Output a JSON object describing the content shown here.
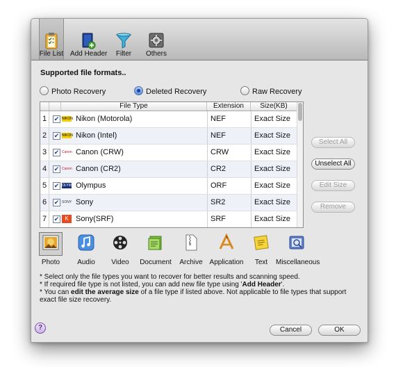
{
  "toolbar": {
    "items": [
      {
        "label": "File List",
        "icon": "clipboard-checklist-icon"
      },
      {
        "label": "Add Header",
        "icon": "book-add-icon"
      },
      {
        "label": "Filter",
        "icon": "funnel-icon"
      },
      {
        "label": "Others",
        "icon": "gear-box-icon"
      }
    ]
  },
  "heading": "Supported file formats..",
  "recovery_modes": [
    {
      "label": "Photo Recovery",
      "selected": false
    },
    {
      "label": "Deleted Recovery",
      "selected": true
    },
    {
      "label": "Raw Recovery",
      "selected": false
    }
  ],
  "table": {
    "headers": [
      "File Type",
      "Extension",
      "Size(KB)"
    ],
    "rows": [
      {
        "num": "1",
        "logo": "NIKON",
        "name": "Nikon (Motorola)",
        "ext": "NEF",
        "size": "Exact Size"
      },
      {
        "num": "2",
        "logo": "NIKON",
        "name": "Nikon (Intel)",
        "ext": "NEF",
        "size": "Exact Size"
      },
      {
        "num": "3",
        "logo": "Canon",
        "name": "Canon (CRW)",
        "ext": "CRW",
        "size": "Exact Size"
      },
      {
        "num": "4",
        "logo": "Canon",
        "name": "Canon (CR2)",
        "ext": "CR2",
        "size": "Exact Size"
      },
      {
        "num": "5",
        "logo": "OLYMPUS",
        "name": "Olympus",
        "ext": "ORF",
        "size": "Exact Size"
      },
      {
        "num": "6",
        "logo": "SONY",
        "name": "Sony",
        "ext": "SR2",
        "size": "Exact Size"
      },
      {
        "num": "7",
        "logo": "K",
        "name": "Sony(SRF)",
        "ext": "SRF",
        "size": "Exact Size"
      }
    ]
  },
  "side_buttons": {
    "select_all": "Select All",
    "unselect_all": "Unselect All",
    "edit_size": "Edit Size",
    "remove": "Remove"
  },
  "categories": [
    {
      "label": "Photo",
      "icon": "photo-icon"
    },
    {
      "label": "Audio",
      "icon": "audio-note-icon"
    },
    {
      "label": "Video",
      "icon": "film-reel-icon"
    },
    {
      "label": "Document",
      "icon": "document-stack-icon"
    },
    {
      "label": "Archive",
      "icon": "archive-zip-icon"
    },
    {
      "label": "Application",
      "icon": "application-icon"
    },
    {
      "label": "Text",
      "icon": "text-note-icon"
    },
    {
      "label": "Miscellaneous",
      "icon": "misc-files-icon"
    }
  ],
  "notes": {
    "line1": "* Select only the file types you want to recover for better results and scanning speed.",
    "line2_pre": "* If required file type is not listed, you can add new file type using '",
    "line2_bold": "Add Header",
    "line2_post": "'.",
    "line3_pre": "* You can ",
    "line3_bold": "edit the average size",
    "line3_post": " of a file type if listed above. Not applicable to file types that support exact file size recovery."
  },
  "footer": {
    "help": "?",
    "cancel": "Cancel",
    "ok": "OK"
  },
  "colors": {
    "window_bg": "#e6e6e6",
    "radio_selected": "#1f3f9e",
    "row_alt": "#eef2f8"
  }
}
